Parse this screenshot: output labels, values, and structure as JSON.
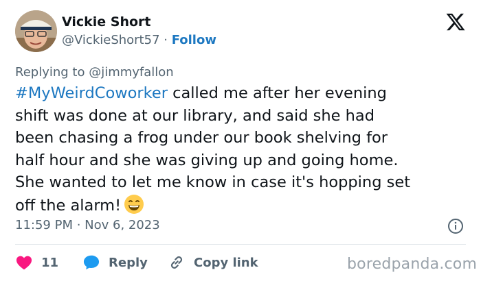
{
  "author": {
    "name": "Vickie Short",
    "handle": "@VickieShort57",
    "separator": " · ",
    "follow_label": "Follow"
  },
  "reply_context": "Replying to @jimmyfallon",
  "tweet": {
    "hashtag": "#MyWeirdCoworker",
    "lines": [
      " called me after her evening",
      "shift was done at our library, and said she had",
      "been chasing a frog under our book shelving for",
      "half hour and she was giving up and going home.",
      "She wanted to let me know in case it's hopping set",
      "off the alarm!"
    ],
    "emoji": "grinning-face-emoji"
  },
  "meta": {
    "time": "11:59 PM",
    "separator": " · ",
    "date": "Nov 6, 2023"
  },
  "actions": {
    "like_count": "11",
    "reply_label": "Reply",
    "copy_label": "Copy link"
  },
  "watermark": "boredpanda.com",
  "colors": {
    "link": "#1d78c1",
    "muted": "#536471",
    "like": "#f91880",
    "reply": "#1d9bf0"
  },
  "icons": {
    "brand": "x-logo-icon",
    "info": "info-icon",
    "like": "heart-icon",
    "reply": "speech-bubble-icon",
    "copy": "link-icon"
  }
}
